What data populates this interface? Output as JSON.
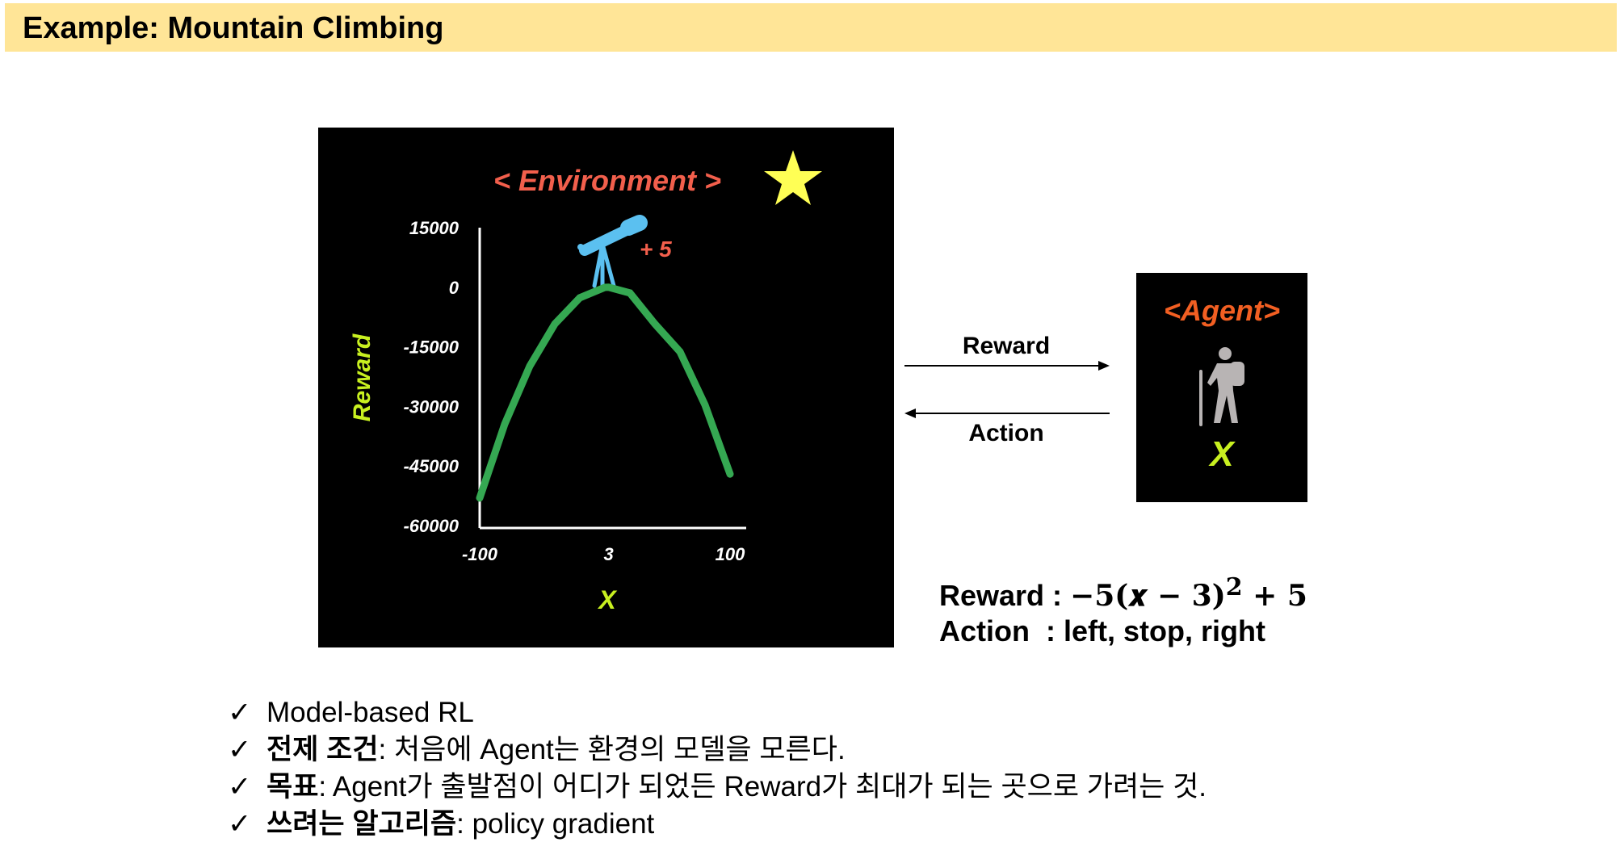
{
  "header": {
    "title": "Example: Mountain Climbing"
  },
  "environment": {
    "label": "< Environment >",
    "label_color": "#f25f4c",
    "star_color": "#ffff55",
    "telescope_color": "#5bc0f0",
    "reward_annotation": "+ 5",
    "reward_annotation_color": "#f25f4c"
  },
  "chart_data": {
    "type": "line",
    "title": "",
    "xlabel": "X",
    "ylabel": "Reward",
    "axis_label_color": "#c8f020",
    "line_color": "#35a852",
    "xlim": [
      -100,
      100
    ],
    "ylim": [
      -60000,
      15000
    ],
    "x_ticks": [
      -100,
      3,
      100
    ],
    "x_tick_labels": [
      "-100",
      "3",
      "100"
    ],
    "y_ticks": [
      15000,
      0,
      -15000,
      -30000,
      -45000,
      -60000
    ],
    "y_tick_labels": [
      "15000",
      "0",
      "-15000",
      "-30000",
      "-45000",
      "-60000"
    ],
    "series": [
      {
        "x": [
          -100,
          -80,
          -60,
          -40,
          -20,
          0,
          3,
          20,
          40,
          60,
          80,
          100
        ],
        "y": [
          -53040,
          -34440,
          -19840,
          -9240,
          -2640,
          -40,
          5,
          -1440,
          -9240,
          -16240,
          -29640,
          -47040
        ]
      }
    ]
  },
  "flow": {
    "reward_label": "Reward",
    "action_label": "Action"
  },
  "agent": {
    "title": "<Agent>",
    "title_color": "#f25f22",
    "hiker_color": "#b8b4b4",
    "x_label": "X",
    "x_color": "#c8f020"
  },
  "formula": {
    "reward_prefix": "Reward : ",
    "reward_math": "−5(𝒙 − 3)",
    "reward_exponent": "2",
    "reward_tail": " + 5",
    "action_line": "Action  : left, stop, right"
  },
  "notes": [
    {
      "check": "✓",
      "bold": "",
      "text": "Model-based RL"
    },
    {
      "check": "✓",
      "bold": "전제 조건",
      "text": ": 처음에 Agent는 환경의 모델을 모른다."
    },
    {
      "check": "✓",
      "bold": "목표",
      "text": ": Agent가 출발점이 어디가 되었든 Reward가 최대가 되는 곳으로 가려는 것."
    },
    {
      "check": "✓",
      "bold": "쓰려는 알고리즘",
      "text": ": policy gradient"
    }
  ]
}
